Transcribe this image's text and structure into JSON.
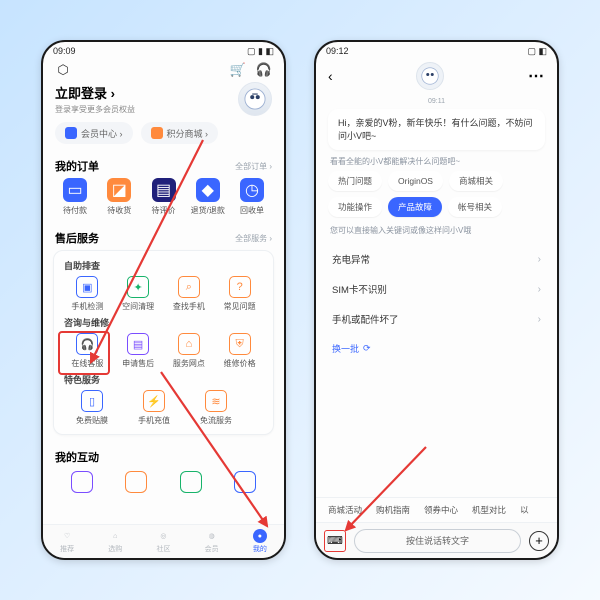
{
  "phone1": {
    "status_time": "09:09",
    "login_title": "立即登录 ›",
    "login_subtitle": "登录享受更多会员权益",
    "pill_member": "会员中心 ›",
    "pill_points": "积分商城 ›",
    "orders_title": "我的订单",
    "orders_more": "全部订单 ›",
    "orders": [
      "待付款",
      "待收货",
      "待评价",
      "退货/退款",
      "回收单"
    ],
    "aftersale_title": "售后服务",
    "aftersale_more": "全部服务 ›",
    "self_check_title": "自助排查",
    "self_check": [
      "手机检测",
      "空间清理",
      "查找手机",
      "常见问题"
    ],
    "consult_title": "咨询与维修",
    "consult": [
      "在线客服",
      "申请售后",
      "服务网点",
      "维修价格"
    ],
    "special_title": "特色服务",
    "special": [
      "免费贴膜",
      "手机充值",
      "免流服务"
    ],
    "interact_title": "我的互动",
    "tabs": [
      "推荐",
      "选购",
      "社区",
      "会员",
      "我的"
    ]
  },
  "phone2": {
    "status_time": "09:12",
    "timestamp": "09:11",
    "greeting": "Hi，亲爱的V粉，新年快乐！有什么问题，不妨问问小V吧~",
    "cat_hint": "看看全能的小V都能解决什么问题吧~",
    "categories": [
      "热门问题",
      "OriginOS",
      "商城相关",
      "功能操作",
      "产品故障",
      "帐号相关"
    ],
    "selected_category": "产品故障",
    "kw_hint": "您可以直接输入关键词或像这样问小V哦",
    "qa": [
      "充电异常",
      "SIM卡不识别",
      "手机或配件坏了"
    ],
    "refresh_label": "换一批",
    "topics": [
      "商城活动",
      "购机指南",
      "领券中心",
      "机型对比",
      "以"
    ],
    "voice_placeholder": "按住说话转文字"
  }
}
